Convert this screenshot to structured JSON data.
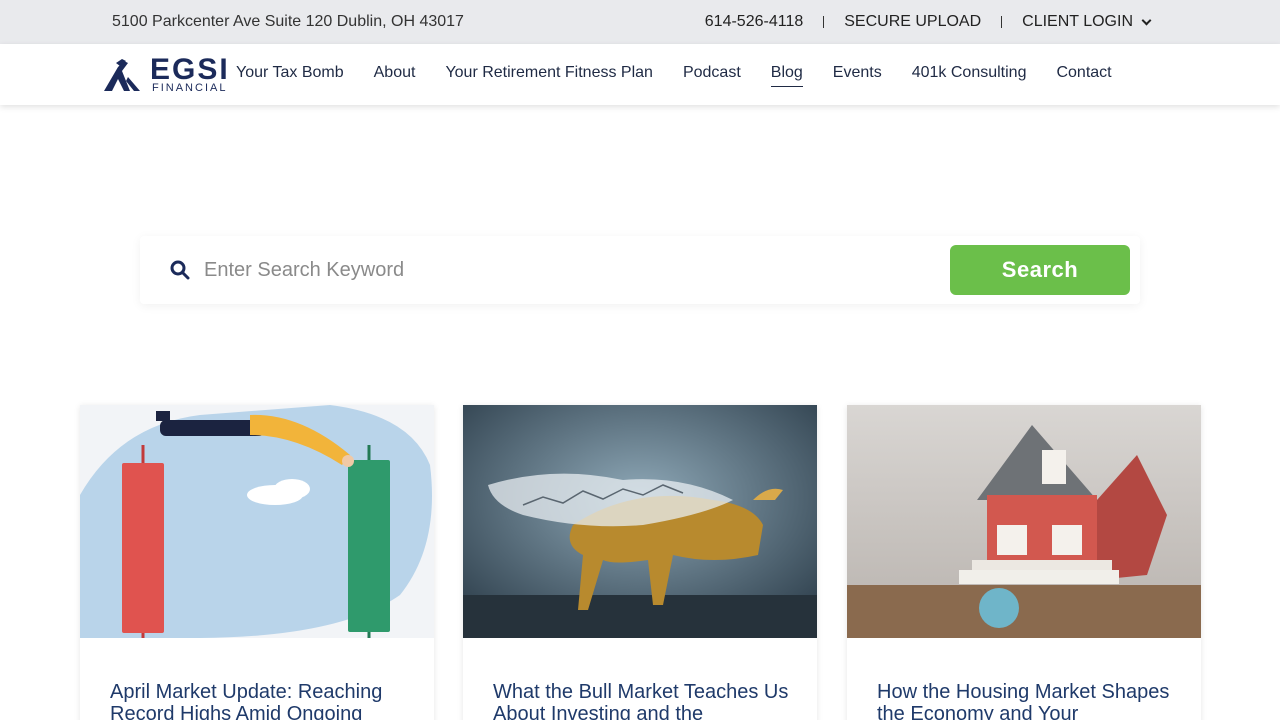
{
  "topbar": {
    "address": "5100 Parkcenter Ave Suite 120 Dublin, OH 43017",
    "phone": "614-526-4118",
    "secure_upload": "SECURE UPLOAD",
    "client_login": "CLIENT LOGIN"
  },
  "logo": {
    "word": "EGSI",
    "sub": "FINANCIAL"
  },
  "nav": {
    "items": [
      {
        "label": "Your Tax Bomb"
      },
      {
        "label": "About"
      },
      {
        "label": "Your Retirement Fitness Plan"
      },
      {
        "label": "Podcast"
      },
      {
        "label": "Blog"
      },
      {
        "label": "Events"
      },
      {
        "label": "401k Consulting"
      },
      {
        "label": "Contact"
      }
    ],
    "active": "Blog"
  },
  "search": {
    "placeholder": "Enter Search Keyword",
    "value": "",
    "button_label": "Search"
  },
  "colors": {
    "brand_navy": "#1b2a5a",
    "search_green": "#6bbf4a",
    "title_blue": "#1f3a6a"
  },
  "posts": [
    {
      "title": "April Market Update: Reaching Record Highs Amid Ongoing"
    },
    {
      "title": "What the Bull Market Teaches Us About Investing and the"
    },
    {
      "title": "How the Housing Market Shapes the Economy and Your"
    }
  ]
}
